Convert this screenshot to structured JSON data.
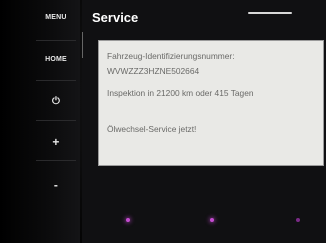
{
  "side_buttons": {
    "menu": "MENU",
    "home": "HOME",
    "power": "⏻",
    "plus": "+",
    "minus": "-"
  },
  "header": {
    "title": "Service"
  },
  "service_info": {
    "vin_label": "Fahrzeug-Identifizierungsnummer:",
    "vin_value": "WVWZZZ3HZNE502664",
    "inspection": "Inspektion in 21200 km oder 415 Tagen",
    "oil_service": "Ölwechsel-Service jetzt!"
  },
  "colors": {
    "panel_background": "#e9e9e6",
    "text": "#6a6a68",
    "indicator": "#c44bd0"
  }
}
